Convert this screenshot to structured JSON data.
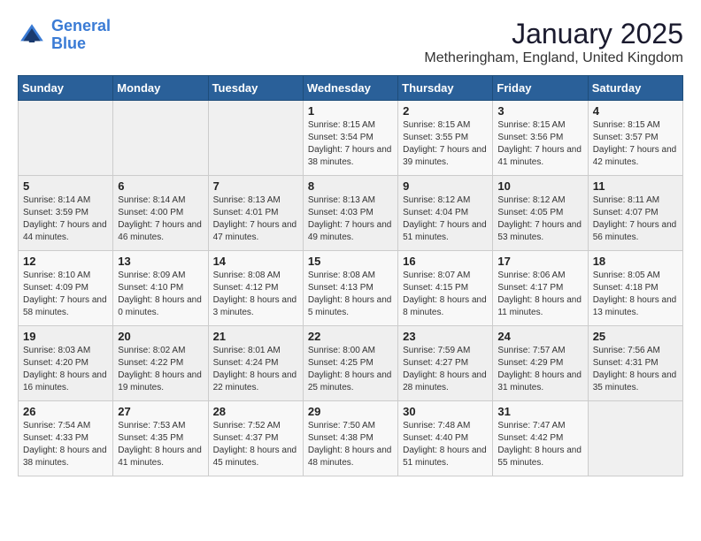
{
  "logo": {
    "line1": "General",
    "line2": "Blue"
  },
  "title": "January 2025",
  "subtitle": "Metheringham, England, United Kingdom",
  "weekdays": [
    "Sunday",
    "Monday",
    "Tuesday",
    "Wednesday",
    "Thursday",
    "Friday",
    "Saturday"
  ],
  "weeks": [
    [
      {
        "day": "",
        "info": ""
      },
      {
        "day": "",
        "info": ""
      },
      {
        "day": "",
        "info": ""
      },
      {
        "day": "1",
        "info": "Sunrise: 8:15 AM\nSunset: 3:54 PM\nDaylight: 7 hours\nand 38 minutes."
      },
      {
        "day": "2",
        "info": "Sunrise: 8:15 AM\nSunset: 3:55 PM\nDaylight: 7 hours\nand 39 minutes."
      },
      {
        "day": "3",
        "info": "Sunrise: 8:15 AM\nSunset: 3:56 PM\nDaylight: 7 hours\nand 41 minutes."
      },
      {
        "day": "4",
        "info": "Sunrise: 8:15 AM\nSunset: 3:57 PM\nDaylight: 7 hours\nand 42 minutes."
      }
    ],
    [
      {
        "day": "5",
        "info": "Sunrise: 8:14 AM\nSunset: 3:59 PM\nDaylight: 7 hours\nand 44 minutes."
      },
      {
        "day": "6",
        "info": "Sunrise: 8:14 AM\nSunset: 4:00 PM\nDaylight: 7 hours\nand 46 minutes."
      },
      {
        "day": "7",
        "info": "Sunrise: 8:13 AM\nSunset: 4:01 PM\nDaylight: 7 hours\nand 47 minutes."
      },
      {
        "day": "8",
        "info": "Sunrise: 8:13 AM\nSunset: 4:03 PM\nDaylight: 7 hours\nand 49 minutes."
      },
      {
        "day": "9",
        "info": "Sunrise: 8:12 AM\nSunset: 4:04 PM\nDaylight: 7 hours\nand 51 minutes."
      },
      {
        "day": "10",
        "info": "Sunrise: 8:12 AM\nSunset: 4:05 PM\nDaylight: 7 hours\nand 53 minutes."
      },
      {
        "day": "11",
        "info": "Sunrise: 8:11 AM\nSunset: 4:07 PM\nDaylight: 7 hours\nand 56 minutes."
      }
    ],
    [
      {
        "day": "12",
        "info": "Sunrise: 8:10 AM\nSunset: 4:09 PM\nDaylight: 7 hours\nand 58 minutes."
      },
      {
        "day": "13",
        "info": "Sunrise: 8:09 AM\nSunset: 4:10 PM\nDaylight: 8 hours\nand 0 minutes."
      },
      {
        "day": "14",
        "info": "Sunrise: 8:08 AM\nSunset: 4:12 PM\nDaylight: 8 hours\nand 3 minutes."
      },
      {
        "day": "15",
        "info": "Sunrise: 8:08 AM\nSunset: 4:13 PM\nDaylight: 8 hours\nand 5 minutes."
      },
      {
        "day": "16",
        "info": "Sunrise: 8:07 AM\nSunset: 4:15 PM\nDaylight: 8 hours\nand 8 minutes."
      },
      {
        "day": "17",
        "info": "Sunrise: 8:06 AM\nSunset: 4:17 PM\nDaylight: 8 hours\nand 11 minutes."
      },
      {
        "day": "18",
        "info": "Sunrise: 8:05 AM\nSunset: 4:18 PM\nDaylight: 8 hours\nand 13 minutes."
      }
    ],
    [
      {
        "day": "19",
        "info": "Sunrise: 8:03 AM\nSunset: 4:20 PM\nDaylight: 8 hours\nand 16 minutes."
      },
      {
        "day": "20",
        "info": "Sunrise: 8:02 AM\nSunset: 4:22 PM\nDaylight: 8 hours\nand 19 minutes."
      },
      {
        "day": "21",
        "info": "Sunrise: 8:01 AM\nSunset: 4:24 PM\nDaylight: 8 hours\nand 22 minutes."
      },
      {
        "day": "22",
        "info": "Sunrise: 8:00 AM\nSunset: 4:25 PM\nDaylight: 8 hours\nand 25 minutes."
      },
      {
        "day": "23",
        "info": "Sunrise: 7:59 AM\nSunset: 4:27 PM\nDaylight: 8 hours\nand 28 minutes."
      },
      {
        "day": "24",
        "info": "Sunrise: 7:57 AM\nSunset: 4:29 PM\nDaylight: 8 hours\nand 31 minutes."
      },
      {
        "day": "25",
        "info": "Sunrise: 7:56 AM\nSunset: 4:31 PM\nDaylight: 8 hours\nand 35 minutes."
      }
    ],
    [
      {
        "day": "26",
        "info": "Sunrise: 7:54 AM\nSunset: 4:33 PM\nDaylight: 8 hours\nand 38 minutes."
      },
      {
        "day": "27",
        "info": "Sunrise: 7:53 AM\nSunset: 4:35 PM\nDaylight: 8 hours\nand 41 minutes."
      },
      {
        "day": "28",
        "info": "Sunrise: 7:52 AM\nSunset: 4:37 PM\nDaylight: 8 hours\nand 45 minutes."
      },
      {
        "day": "29",
        "info": "Sunrise: 7:50 AM\nSunset: 4:38 PM\nDaylight: 8 hours\nand 48 minutes."
      },
      {
        "day": "30",
        "info": "Sunrise: 7:48 AM\nSunset: 4:40 PM\nDaylight: 8 hours\nand 51 minutes."
      },
      {
        "day": "31",
        "info": "Sunrise: 7:47 AM\nSunset: 4:42 PM\nDaylight: 8 hours\nand 55 minutes."
      },
      {
        "day": "",
        "info": ""
      }
    ]
  ]
}
